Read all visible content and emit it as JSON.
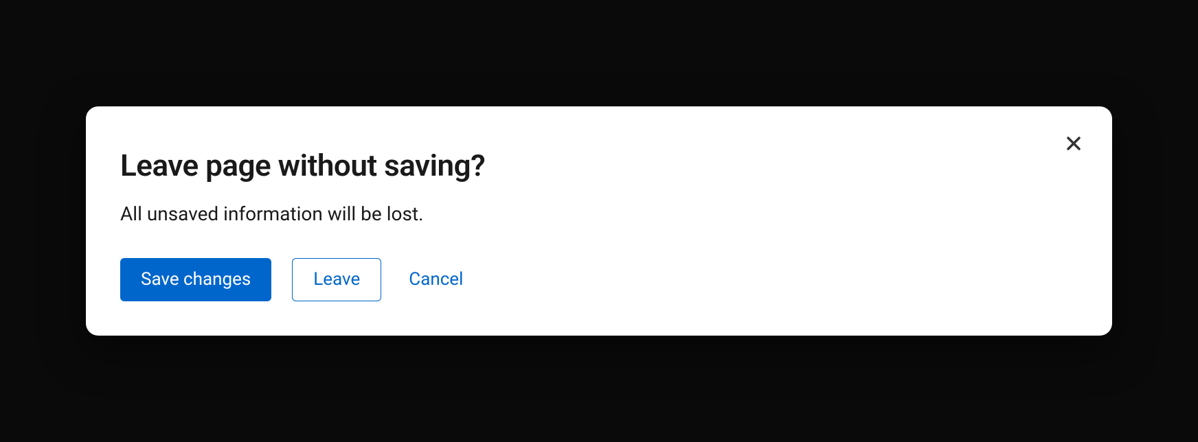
{
  "modal": {
    "title": "Leave page without saving?",
    "body": "All unsaved information will be lost.",
    "actions": {
      "primary": "Save changes",
      "secondary": "Leave",
      "tertiary": "Cancel"
    }
  }
}
